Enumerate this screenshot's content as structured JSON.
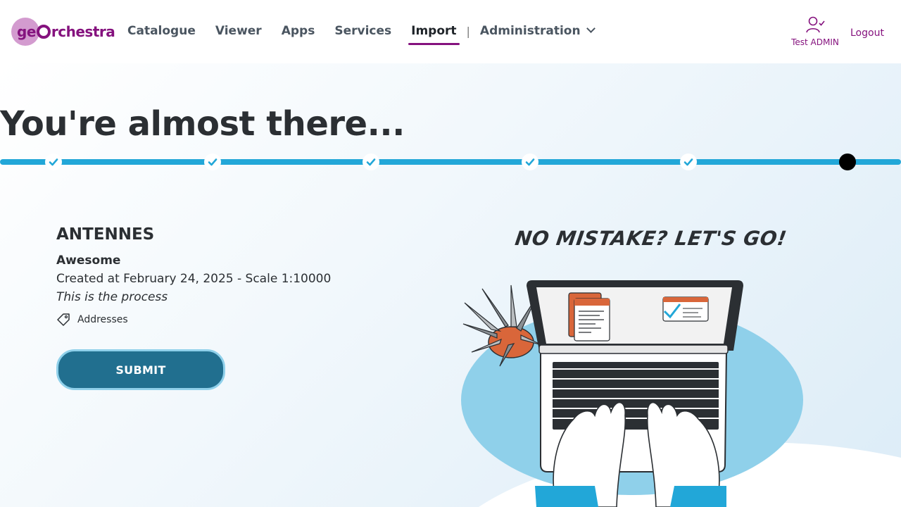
{
  "header": {
    "logo_text_prefix": "ge",
    "logo_text_suffix": "rchestra",
    "nav": [
      {
        "label": "Catalogue"
      },
      {
        "label": "Viewer"
      },
      {
        "label": "Apps"
      },
      {
        "label": "Services"
      },
      {
        "label": "Import",
        "active": true
      },
      {
        "label": "Administration"
      }
    ],
    "separator": "|",
    "user_name": "Test ADMIN",
    "logout_label": "Logout"
  },
  "main": {
    "title": "You're almost there...",
    "steps_completed": 5,
    "steps_total": 6,
    "layer": {
      "name": "ANTENNES",
      "subtitle": "Awesome",
      "meta": "Created at  February 24, 2025 - Scale  1:10000",
      "description": "This is the process",
      "tag": "Addresses"
    },
    "submit_label": "SUBMIT",
    "illustration_caption": "NO MISTAKE? LET'S GO!"
  },
  "colors": {
    "brand": "#85127e",
    "progress": "#22a7d8",
    "submit": "#216f8f",
    "illustration_blob": "#8fd0ea"
  },
  "icons": [
    "user-check-icon",
    "chevron-down-icon",
    "check-icon",
    "tag-icon",
    "laptop-illustration"
  ]
}
